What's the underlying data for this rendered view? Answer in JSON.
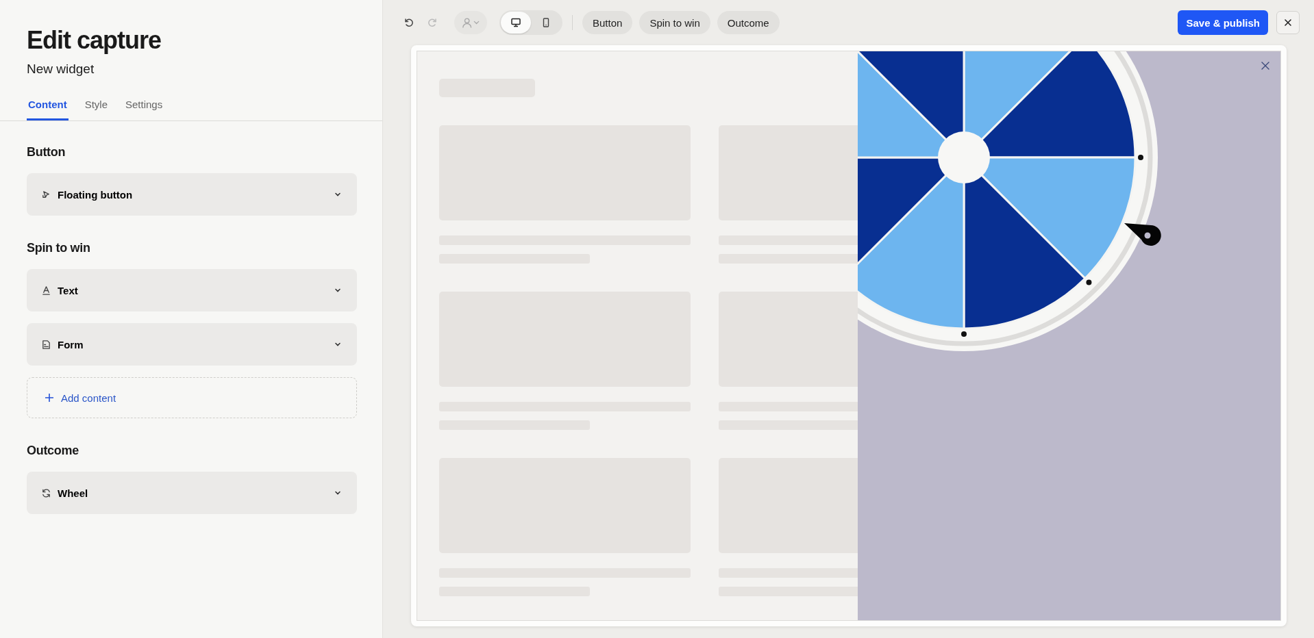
{
  "panel": {
    "title": "Edit capture",
    "subtitle": "New widget",
    "tabs": [
      {
        "label": "Content",
        "selected": true
      },
      {
        "label": "Style",
        "selected": false
      },
      {
        "label": "Settings",
        "selected": false
      }
    ],
    "sections": [
      {
        "heading": "Button",
        "items": [
          {
            "label": "Floating button",
            "kind": "cursor"
          }
        ]
      },
      {
        "heading": "Spin to win",
        "items": [
          {
            "label": "Text",
            "kind": "text"
          },
          {
            "label": "Form",
            "kind": "form"
          }
        ],
        "add_label": "Add content"
      },
      {
        "heading": "Outcome",
        "items": [
          {
            "label": "Wheel",
            "kind": "refresh"
          }
        ]
      }
    ]
  },
  "toolbar": {
    "undo": {
      "disabled": false
    },
    "redo": {
      "disabled": true
    },
    "devices": [
      {
        "kind": "desktop",
        "selected": true
      },
      {
        "kind": "mobile",
        "selected": false
      }
    ],
    "chips": [
      "Button",
      "Spin to win",
      "Outcome"
    ],
    "save_label": "Save & publish"
  }
}
